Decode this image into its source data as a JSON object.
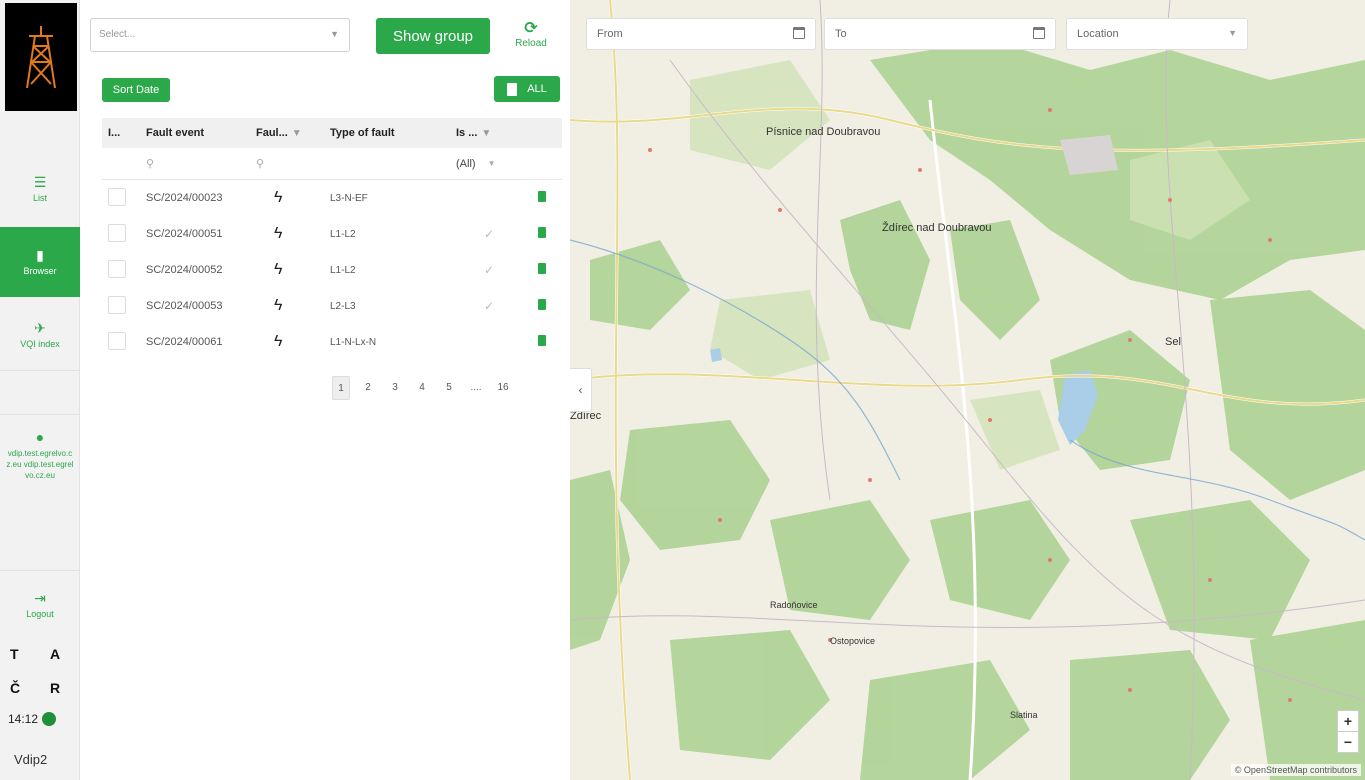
{
  "sidebar": {
    "items": [
      {
        "label": "List",
        "icon": "list-icon"
      },
      {
        "label": "Browser",
        "icon": "map-icon"
      },
      {
        "label": "VQI index",
        "icon": "pulse-icon"
      }
    ],
    "user": {
      "label": "vdip.test.egrelvo.cz.eu vdip.test.egrelvo.cz.eu",
      "icon": "user-icon"
    },
    "logout": {
      "label": "Logout",
      "icon": "logout-icon"
    },
    "lang": [
      "T",
      "A",
      "Č",
      "R"
    ],
    "time": "14:12",
    "version": "Vdip2",
    "accent": "#2ba84a"
  },
  "toolbar": {
    "select_placeholder": "Select...",
    "show_group": "Show group",
    "reload": "Reload",
    "sort_date": "Sort Date",
    "all": "ALL"
  },
  "grid": {
    "columns": [
      "I...",
      "Fault event",
      "Faul...",
      "Type of fault",
      "Is ..."
    ],
    "filter_all": "(All)",
    "rows": [
      {
        "event": "SC/2024/00023",
        "type": "L3-N-EF",
        "is": ""
      },
      {
        "event": "SC/2024/00051",
        "type": "L1-L2",
        "is": "✓"
      },
      {
        "event": "SC/2024/00052",
        "type": "L1-L2",
        "is": "✓"
      },
      {
        "event": "SC/2024/00053",
        "type": "L2-L3",
        "is": "✓"
      },
      {
        "event": "SC/2024/00061",
        "type": "L1-N-Lx-N",
        "is": ""
      }
    ],
    "pager": [
      "1",
      "2",
      "3",
      "4",
      "5",
      "....",
      "16"
    ]
  },
  "map": {
    "from_placeholder": "From",
    "to_placeholder": "To",
    "location_placeholder": "Location",
    "labels": [
      "Písnice nad Doubravou",
      "Ždírec nad Doubravou",
      "Sel",
      "Ždírec",
      "Radoňovice",
      "Ostopovice",
      "Slatina"
    ],
    "attribution": "© OpenStreetMap contributors"
  }
}
